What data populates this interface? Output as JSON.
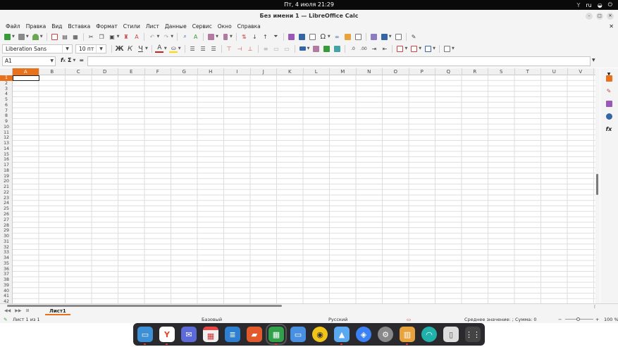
{
  "system": {
    "clock": "Пт, 4 июля  21:29",
    "lang": "ru"
  },
  "window": {
    "title": "Без имени 1 — LibreOffice Calc"
  },
  "menu": {
    "items": [
      "Файл",
      "Правка",
      "Вид",
      "Вставка",
      "Формат",
      "Стили",
      "Лист",
      "Данные",
      "Сервис",
      "Окно",
      "Справка"
    ]
  },
  "format_toolbar": {
    "font_name": "Liberation Sans",
    "font_size": "10 пт",
    "bold": "Ж",
    "italic": "К",
    "underline": "Ч",
    "font_color_letter": "A"
  },
  "formula_bar": {
    "name_box": "A1",
    "func_label": "f",
    "sum_label": "Σ",
    "equals_label": "="
  },
  "grid": {
    "columns": [
      "A",
      "B",
      "C",
      "D",
      "E",
      "F",
      "G",
      "H",
      "I",
      "J",
      "K",
      "L",
      "M",
      "N",
      "O",
      "P",
      "Q",
      "R",
      "S",
      "T",
      "U",
      "V"
    ],
    "rows": [
      "1",
      "2",
      "3",
      "4",
      "5",
      "6",
      "7",
      "8",
      "9",
      "10",
      "11",
      "12",
      "13",
      "14",
      "15",
      "16",
      "17",
      "18",
      "19",
      "20",
      "21",
      "22",
      "23",
      "24",
      "25",
      "26",
      "27",
      "28",
      "29",
      "30",
      "31",
      "32",
      "33",
      "34",
      "35",
      "36",
      "37",
      "38",
      "39",
      "40",
      "41",
      "42"
    ],
    "selected_cell": "A1",
    "selection_color": "#e8711c"
  },
  "sheets": {
    "tabs": [
      "Лист1"
    ]
  },
  "status": {
    "sheet_info": "Лист 1 из 1",
    "page_style": "Базовый",
    "language": "Русский",
    "selection_summary": "Среднее значение: ; Сумма: 0",
    "zoom": "100 %"
  },
  "dock": {
    "apps": [
      "files",
      "yandex-browser",
      "mail",
      "calendar",
      "writer",
      "impress",
      "calc",
      "image-viewer",
      "disk",
      "app-store",
      "browser",
      "settings",
      "gallery",
      "system-monitor",
      "trash",
      "app-grid"
    ]
  }
}
